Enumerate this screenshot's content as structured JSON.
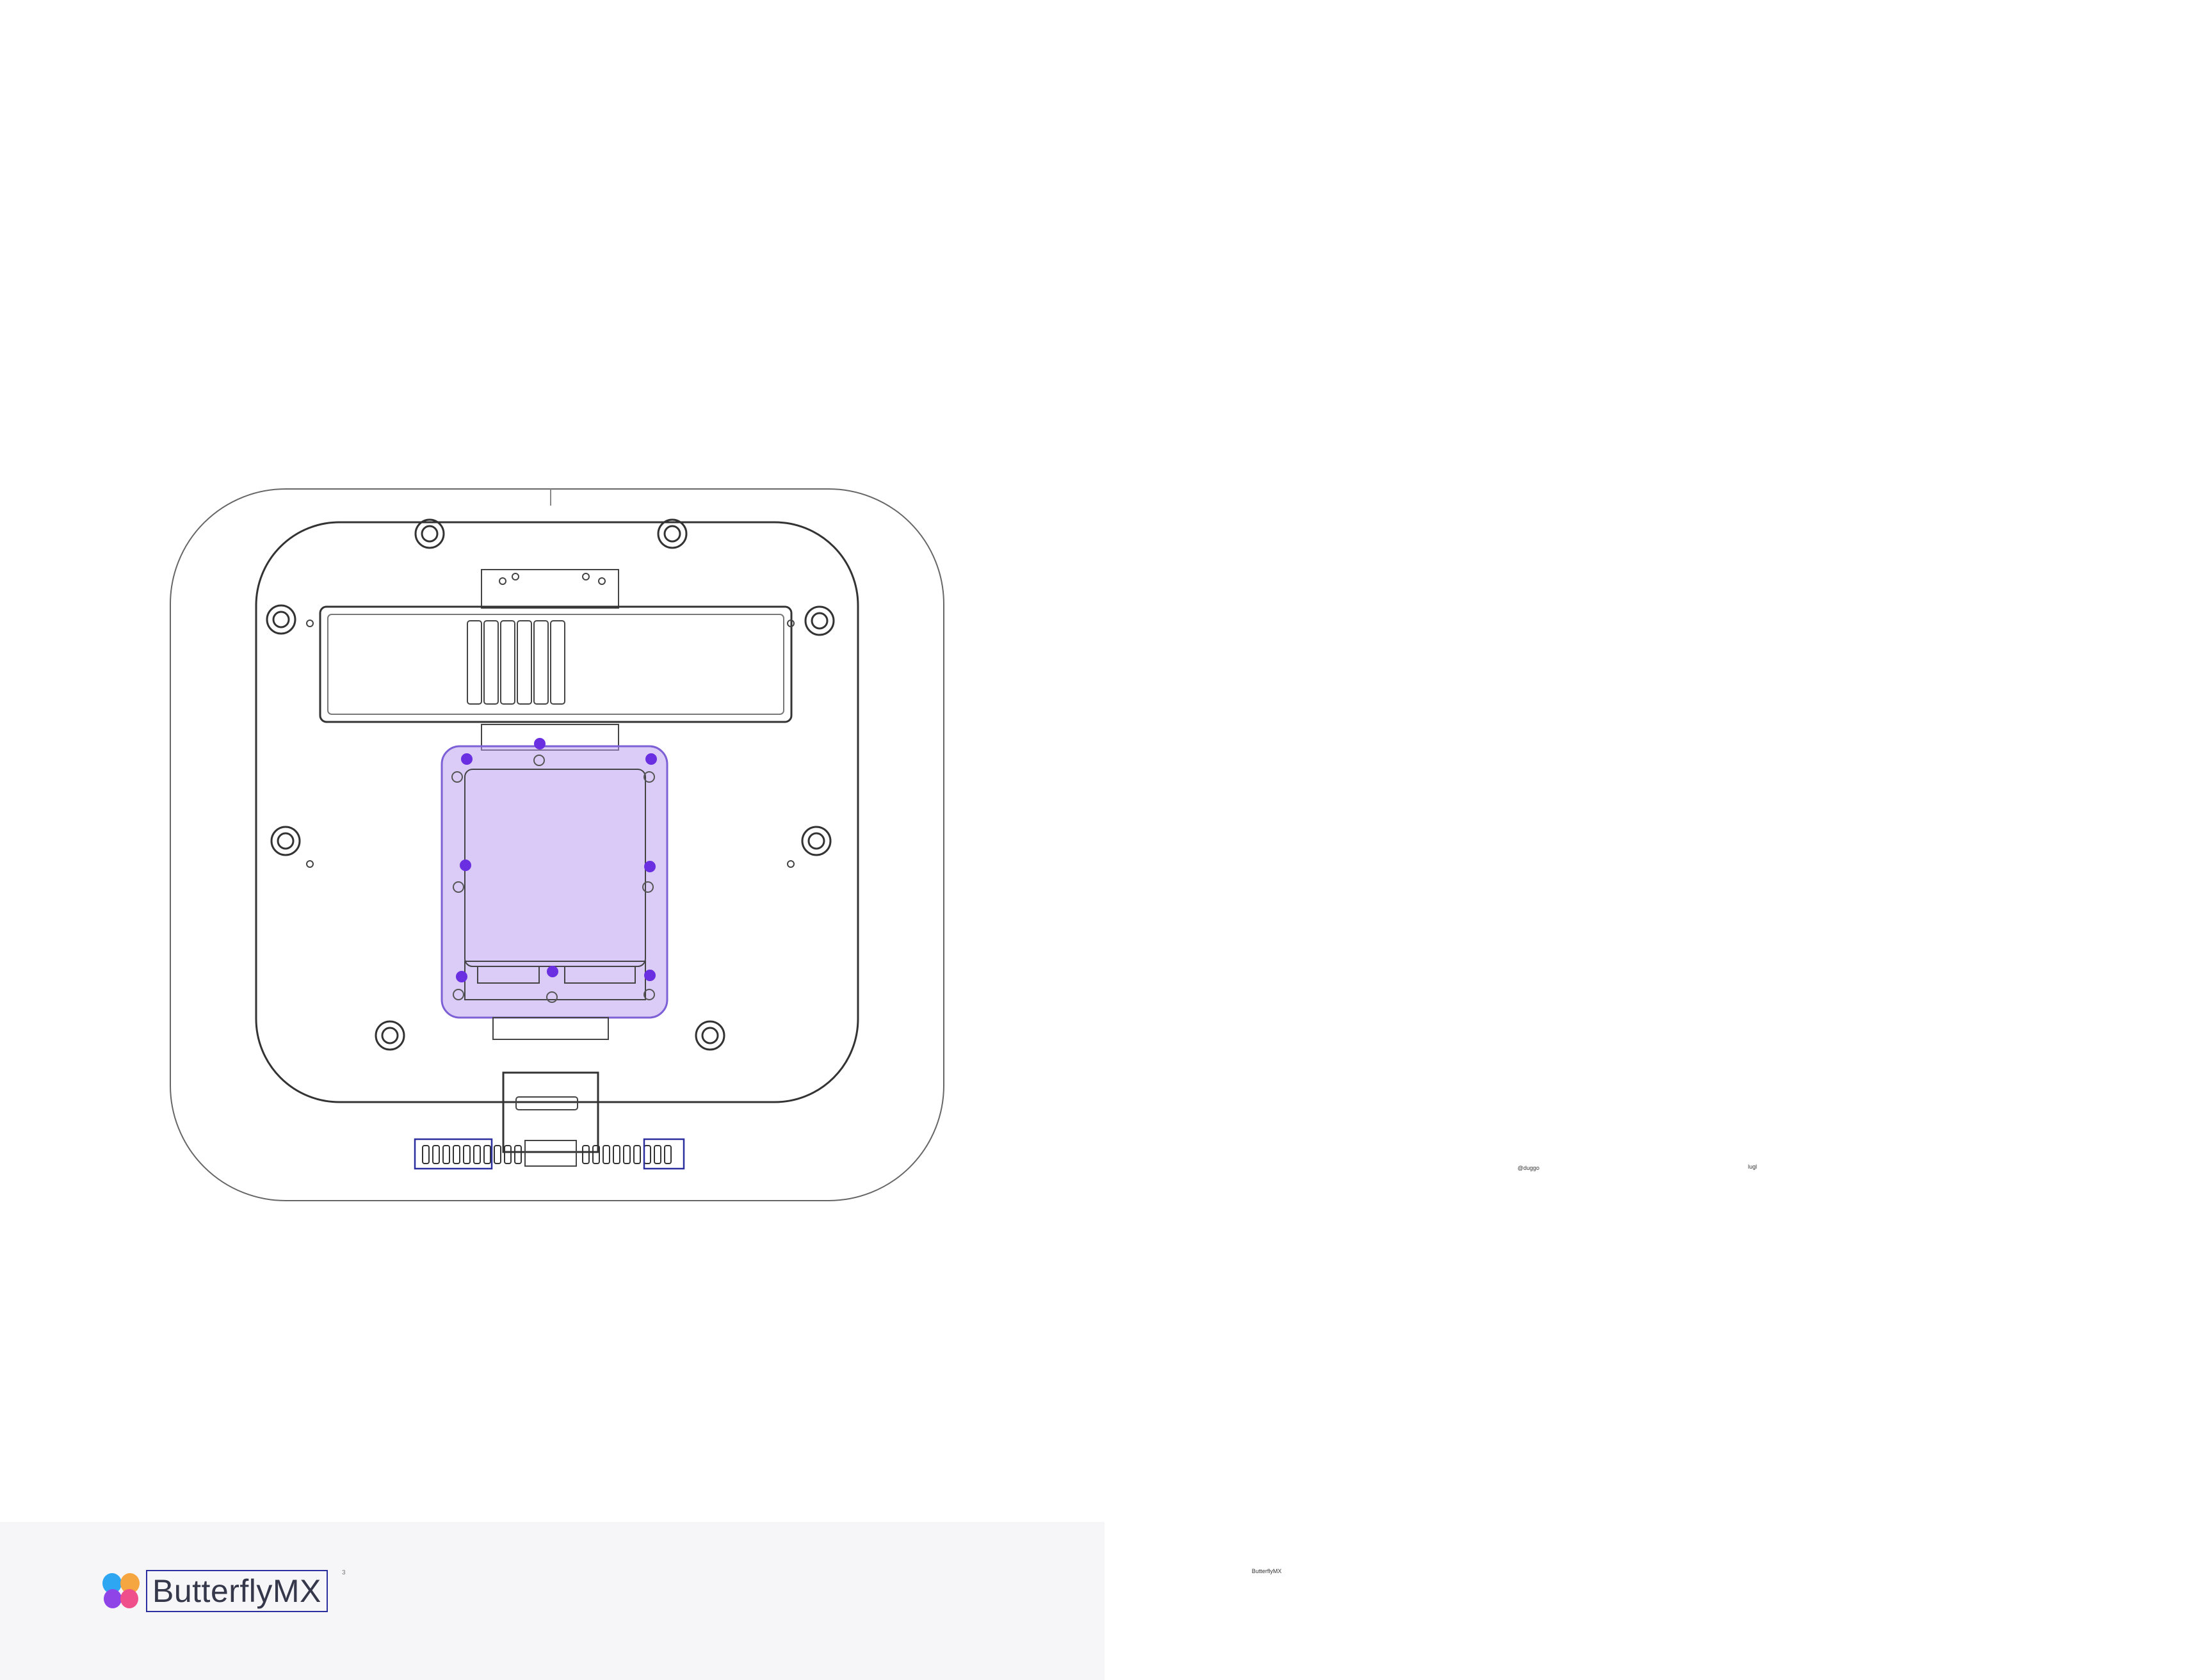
{
  "brand": {
    "name": "ButterflyMX",
    "superscript": "3"
  },
  "footer_text": "ButterflyMX",
  "notes": {
    "left": "@duggo",
    "right": "lugl"
  },
  "colors": {
    "overlay": "#b69af0",
    "screw": "#6a2fe0",
    "outline": "#2b2f9e",
    "footer_bg": "#f6f6f8",
    "logo_blue": "#2fa6f2",
    "logo_purple": "#8e44e6",
    "logo_pink": "#ef4f8a",
    "logo_orange": "#f6a640"
  }
}
